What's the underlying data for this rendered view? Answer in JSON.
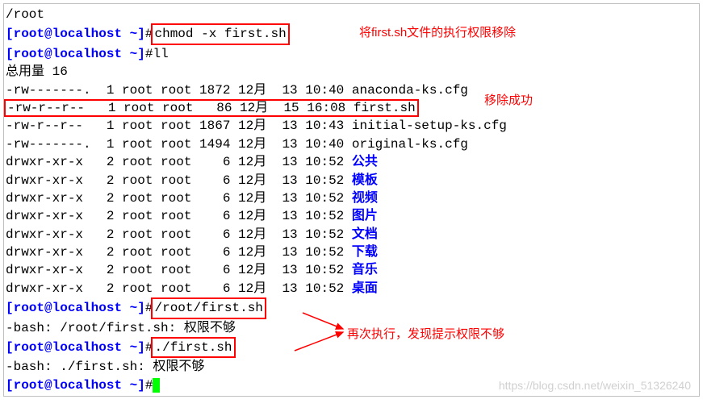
{
  "prompt": {
    "user": "root",
    "host": "localhost",
    "path": "~",
    "symbol": "#"
  },
  "commands": {
    "truncated": "/root",
    "chmod": "chmod -x first.sh",
    "ll": "ll",
    "exec1": "/root/first.sh",
    "exec2": "./first.sh"
  },
  "total_label": "总用量 16",
  "files": [
    {
      "perms": "-rw-------.",
      "links": "1",
      "owner": "root",
      "group": "root",
      "size": "1872",
      "month": "12月",
      "day": "13",
      "time": "10:40",
      "name": "anaconda-ks.cfg",
      "color": "black"
    },
    {
      "perms": "-rw-r--r--",
      "links": "1",
      "owner": "root",
      "group": "root",
      "size": "  86",
      "month": "12月",
      "day": "15",
      "time": "16:08",
      "name": "first.sh",
      "color": "black"
    },
    {
      "perms": "-rw-r--r--",
      "links": "1",
      "owner": "root",
      "group": "root",
      "size": "1867",
      "month": "12月",
      "day": "13",
      "time": "10:43",
      "name": "initial-setup-ks.cfg",
      "color": "black"
    },
    {
      "perms": "-rw-------.",
      "links": "1",
      "owner": "root",
      "group": "root",
      "size": "1494",
      "month": "12月",
      "day": "13",
      "time": "10:40",
      "name": "original-ks.cfg",
      "color": "black"
    },
    {
      "perms": "drwxr-xr-x",
      "links": "2",
      "owner": "root",
      "group": "root",
      "size": "   6",
      "month": "12月",
      "day": "13",
      "time": "10:52",
      "name": "公共",
      "color": "blue"
    },
    {
      "perms": "drwxr-xr-x",
      "links": "2",
      "owner": "root",
      "group": "root",
      "size": "   6",
      "month": "12月",
      "day": "13",
      "time": "10:52",
      "name": "模板",
      "color": "blue"
    },
    {
      "perms": "drwxr-xr-x",
      "links": "2",
      "owner": "root",
      "group": "root",
      "size": "   6",
      "month": "12月",
      "day": "13",
      "time": "10:52",
      "name": "视频",
      "color": "blue"
    },
    {
      "perms": "drwxr-xr-x",
      "links": "2",
      "owner": "root",
      "group": "root",
      "size": "   6",
      "month": "12月",
      "day": "13",
      "time": "10:52",
      "name": "图片",
      "color": "blue"
    },
    {
      "perms": "drwxr-xr-x",
      "links": "2",
      "owner": "root",
      "group": "root",
      "size": "   6",
      "month": "12月",
      "day": "13",
      "time": "10:52",
      "name": "文档",
      "color": "blue"
    },
    {
      "perms": "drwxr-xr-x",
      "links": "2",
      "owner": "root",
      "group": "root",
      "size": "   6",
      "month": "12月",
      "day": "13",
      "time": "10:52",
      "name": "下载",
      "color": "blue"
    },
    {
      "perms": "drwxr-xr-x",
      "links": "2",
      "owner": "root",
      "group": "root",
      "size": "   6",
      "month": "12月",
      "day": "13",
      "time": "10:52",
      "name": "音乐",
      "color": "blue"
    },
    {
      "perms": "drwxr-xr-x",
      "links": "2",
      "owner": "root",
      "group": "root",
      "size": "   6",
      "month": "12月",
      "day": "13",
      "time": "10:52",
      "name": "桌面",
      "color": "blue"
    }
  ],
  "errors": {
    "err1": "-bash: /root/first.sh: 权限不够",
    "err2": "-bash: ./first.sh: 权限不够"
  },
  "annotations": {
    "a1": "将first.sh文件的执行权限移除",
    "a2": "移除成功",
    "a3": "再次执行，发现提示权限不够"
  },
  "watermark": "https://blog.csdn.net/weixin_51326240"
}
